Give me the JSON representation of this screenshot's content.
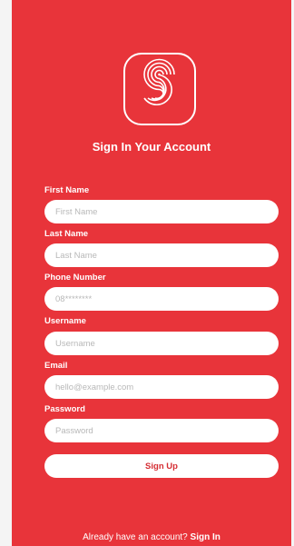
{
  "logo": {
    "icon": "stylized-s-logo-icon"
  },
  "heading": "Sign In Your Account",
  "fields": [
    {
      "label": "First Name",
      "placeholder": "First Name",
      "value": ""
    },
    {
      "label": "Last Name",
      "placeholder": "Last Name",
      "value": ""
    },
    {
      "label": "Phone Number",
      "placeholder": "08********",
      "value": ""
    },
    {
      "label": "Username",
      "placeholder": "Username",
      "value": ""
    },
    {
      "label": "Email",
      "placeholder": "hello@example.com",
      "value": ""
    },
    {
      "label": "Password",
      "placeholder": "Password",
      "value": ""
    }
  ],
  "submit_label": "Sign Up",
  "footer": {
    "text": "Already have an account?",
    "link": "Sign In"
  },
  "colors": {
    "background": "#e8343a",
    "text": "#ffffff",
    "button_text": "#d52d33"
  }
}
